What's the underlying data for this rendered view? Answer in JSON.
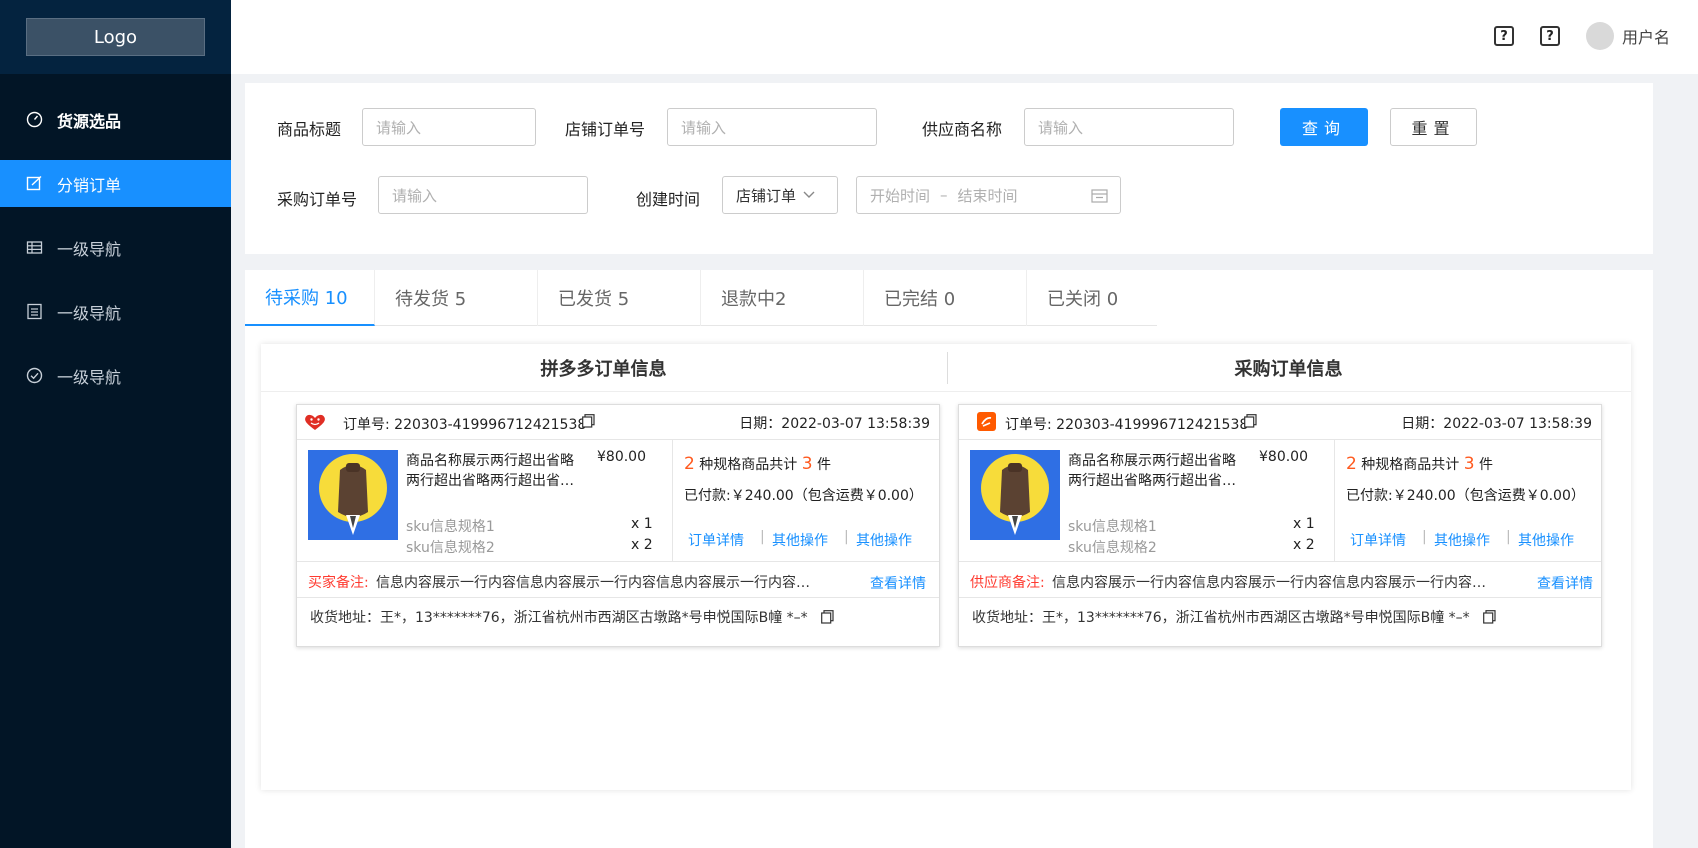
{
  "sidebar": {
    "logo": "Logo",
    "items": [
      {
        "label": "货源选品",
        "icon": "dashboard-icon"
      },
      {
        "label": "分销订单",
        "icon": "edit-icon"
      },
      {
        "label": "一级导航",
        "icon": "table-icon"
      },
      {
        "label": "一级导航",
        "icon": "list-icon"
      },
      {
        "label": "一级导航",
        "icon": "check-circle-icon"
      }
    ]
  },
  "header": {
    "help1": "?",
    "help2": "?",
    "username": "用户名"
  },
  "filters": {
    "product_title_label": "商品标题",
    "product_title_placeholder": "请输入",
    "shop_order_label": "店铺订单号",
    "shop_order_placeholder": "请输入",
    "supplier_label": "供应商名称",
    "supplier_placeholder": "请输入",
    "query_button": "查询",
    "reset_button": "重置",
    "purchase_order_label": "采购订单号",
    "purchase_order_placeholder": "请输入",
    "created_time_label": "创建时间",
    "time_type_value": "店铺订单",
    "start_placeholder": "开始时间",
    "range_sep": "–",
    "end_placeholder": "结束时间"
  },
  "tabs": [
    {
      "label": "待采购 10"
    },
    {
      "label": "待发货 5"
    },
    {
      "label": "已发货 5"
    },
    {
      "label": "退款中2"
    },
    {
      "label": "已完结 0"
    },
    {
      "label": "已关闭 0"
    }
  ],
  "panel": {
    "left_title": "拼多多订单信息",
    "right_title": "采购订单信息"
  },
  "cards": [
    {
      "order_no": "订单号: 220303-419996712421538",
      "date": "日期：2022-03-07 13:58:39",
      "product_name_line1": "商品名称展示两行超出省略",
      "product_name_line2": "两行超出省略两行超出省…",
      "price": "¥80.00",
      "sku1": "sku信息规格1",
      "sku1_qty": "x 1",
      "sku2": "sku信息规格2",
      "sku2_qty": "x 2",
      "spec_count": "2",
      "spec_text": "种规格商品共计",
      "item_count": "3",
      "item_unit": "件",
      "paid": "已付款:￥240.00（包含运费￥0.00）",
      "link1": "订单详情",
      "link2": "其他操作",
      "link3": "其他操作",
      "note_label": "买家备注:",
      "note_text": "信息内容展示一行内容信息内容展示一行内容信息内容展示一行内容…",
      "note_link": "查看详情",
      "address": "收货地址：王*，13*******76，浙江省杭州市西湖区古墩路*号申悦国际B幢 *–*"
    },
    {
      "order_no": "订单号: 220303-419996712421538",
      "date": "日期：2022-03-07 13:58:39",
      "product_name_line1": "商品名称展示两行超出省略",
      "product_name_line2": "两行超出省略两行超出省…",
      "price": "¥80.00",
      "sku1": "sku信息规格1",
      "sku1_qty": "x 1",
      "sku2": "sku信息规格2",
      "sku2_qty": "x 2",
      "spec_count": "2",
      "spec_text": "种规格商品共计",
      "item_count": "3",
      "item_unit": "件",
      "paid": "已付款:￥240.00（包含运费￥0.00）",
      "link1": "订单详情",
      "link2": "其他操作",
      "link3": "其他操作",
      "note_label": "供应商备注:",
      "note_text": "信息内容展示一行内容信息内容展示一行内容信息内容展示一行内容…",
      "note_link": "查看详情",
      "address": "收货地址：王*，13*******76，浙江省杭州市西湖区古墩路*号申悦国际B幢 *–*"
    }
  ],
  "colors": {
    "sidebar_bg": "#021526",
    "accent": "#1890ff",
    "orange": "#ff5a1f",
    "note_red": "#ff3b30"
  }
}
